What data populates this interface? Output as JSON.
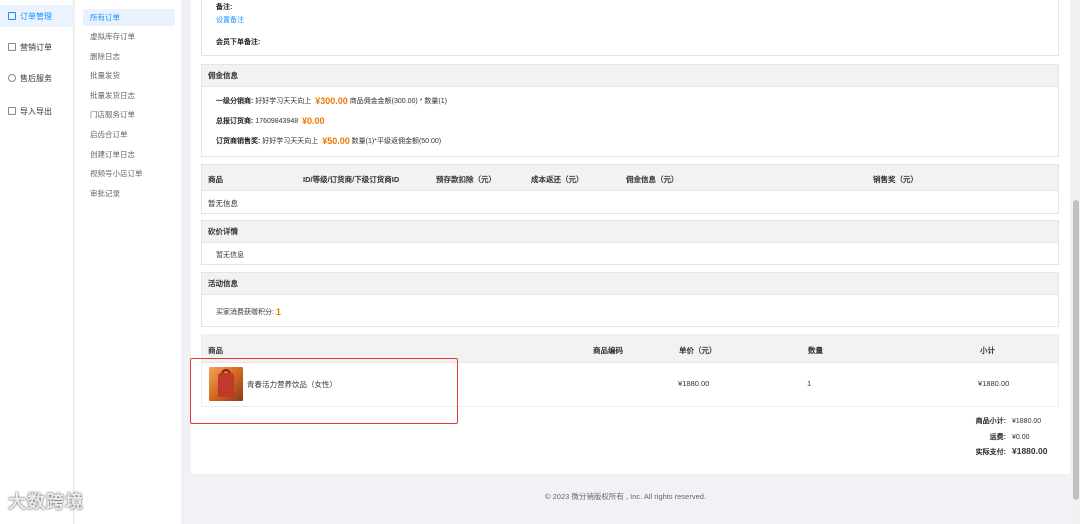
{
  "sidebar_main": [
    {
      "label": "订单管理",
      "icon": "order-icon"
    },
    {
      "label": "营销订单",
      "icon": "marketing-icon"
    },
    {
      "label": "售后服务",
      "icon": "aftersale-icon"
    },
    {
      "label": "导入导出",
      "icon": "import-export-icon"
    }
  ],
  "sidebar_sub": [
    "所有订单",
    "虚拟库存订单",
    "删除日志",
    "批量发货",
    "批量发货日志",
    "门店服务订单",
    "启齿合订单",
    "创建订单日志",
    "视频号小店订单",
    "审批记录"
  ],
  "remark": {
    "label": "备注:",
    "link": "设置备注",
    "member_label": "会员下单备注:"
  },
  "commission": {
    "title": "佣金信息",
    "rows": [
      {
        "label": "一级分销商:",
        "name": "好好学习天天向上",
        "amount": "¥300.00",
        "note": "商品佣金金额(300.00) * 数量(1)"
      },
      {
        "label": "总报订货商:",
        "name": "17609843948",
        "amount": "¥0.00",
        "note": ""
      },
      {
        "label": "订货商销售奖:",
        "name": "好好学习天天向上",
        "amount": "¥50.00",
        "note": "数量(1)*平级返佣金额(50.00)"
      }
    ]
  },
  "settle_table": {
    "headers": [
      "商品",
      "ID/等级/订货商/下级订货商ID",
      "预存款扣除（元）",
      "成本返还（元）",
      "佣金信息（元）",
      "销售奖（元）"
    ],
    "empty": "暂无信息"
  },
  "bargain": {
    "title": "砍价详情",
    "empty": "暂无信息"
  },
  "activity": {
    "title": "活动信息",
    "label": "买家消费获赠积分:",
    "value": "1"
  },
  "goods_table": {
    "headers": [
      "商品",
      "商品编码",
      "单价（元）",
      "数量",
      "小计"
    ],
    "rows": [
      {
        "name": "青春活力营养饮品（女性）",
        "code": "",
        "price": "¥1880.00",
        "qty": "1",
        "subtotal": "¥1880.00"
      }
    ]
  },
  "summary": {
    "goods_label": "商品小计:",
    "goods_value": "¥1880.00",
    "freight_label": "运费:",
    "freight_value": "¥0.00",
    "pay_label": "实际支付:",
    "pay_value": "¥1880.00"
  },
  "footer": "© 2023 微分销版权所有 , Inc. All rights reserved.",
  "watermark": "大数跨境",
  "colors": {
    "accent": "#1890ff",
    "price": "#ee7700",
    "highlight_border": "#e53935"
  }
}
